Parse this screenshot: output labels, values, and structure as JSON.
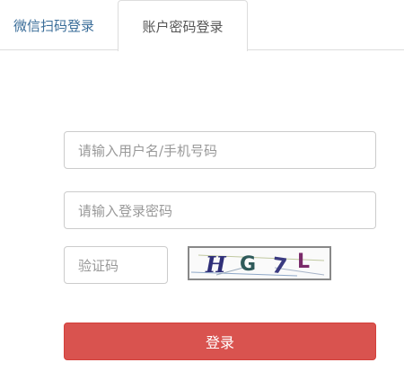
{
  "tabs": {
    "wechat_label": "微信扫码登录",
    "account_label": "账户密码登录"
  },
  "form": {
    "username_placeholder": "请输入用户名/手机号码",
    "password_placeholder": "请输入登录密码",
    "code_placeholder": "验证码",
    "captcha_text": "HG7L",
    "login_label": "登录"
  },
  "colors": {
    "login_button": "#d9534f",
    "active_tab_text": "#555555",
    "inactive_tab_text": "#3a6d99"
  }
}
